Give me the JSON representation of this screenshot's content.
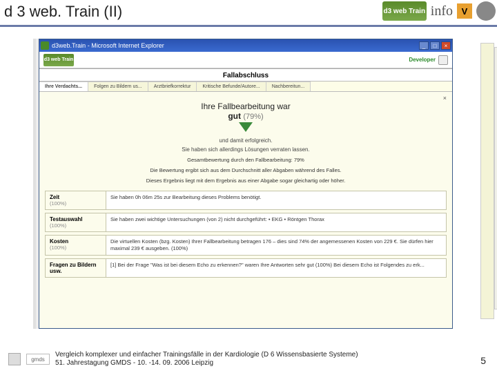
{
  "slide": {
    "title": "d 3 web. Train (II)",
    "page_number": "5"
  },
  "logos": {
    "d3web": "d3 web Train",
    "info": "info",
    "v": "V"
  },
  "browser": {
    "title": "d3web.Train - Microsoft Internet Explorer",
    "mini_logo": "d3 web Train",
    "developer": "Developer"
  },
  "page": {
    "header": "Fallabschluss",
    "tabs": [
      "Ihre Verdachts...",
      "Folgen zu Bildern us...",
      "Arztbriefkorrektur",
      "Kritische Befunde/Autore...",
      "Nachbereitun..."
    ],
    "close": "×",
    "result": {
      "line1": "Ihre Fallbearbeitung war",
      "good": "gut",
      "pct": "(79%)",
      "sub1": "und damit erfolgreich.",
      "sub2": "Sie haben sich allerdings Lösungen verraten lassen.",
      "para1": "Gesamtbewertung durch den Fallbearbeitung: 79%",
      "para2": "Die Bewertung ergibt sich aus dem Durchschnitt aller Abgaben während des Falles.",
      "para3": "Dieses Ergebnis liegt mit dem Ergebnis aus einer Abgabe sogar gleichartig oder höher."
    },
    "rows": [
      {
        "label": "Zeit",
        "score": "(100%)",
        "body": "Sie haben 0h 06m 25s zur Bearbeitung dieses Problems benötigt."
      },
      {
        "label": "Testauswahl",
        "score": "(100%)",
        "body": "Sie haben zwei wichtige Untersuchungen (von 2) nicht durchgeführt: • EKG • Röntgen Thorax"
      },
      {
        "label": "Kosten",
        "score": "(100%)",
        "body": "Die virtuellen Kosten (bzg. Kosten) Ihrer Fallbearbeitung betragen 176 – dies sind 74% der angemessenen Kosten von 229 €. Sie dürfen hier maximal 239 € ausgeben. (100%)"
      },
      {
        "label": "Fragen zu Bildern usw.",
        "score": "",
        "body": "[1] Bei der Frage \"Was ist bei diesem Echo zu erkennen?\" waren Ihre Antworten sehr gut (100%)\nBei diesem Echo ist Folgendes zu erk..."
      }
    ]
  },
  "footer": {
    "gmds": "gmds",
    "line1": "Vergleich komplexer und einfacher Trainingsfälle in der Kardiologie (D 6 Wissensbasierte Systeme)",
    "line2": "51. Jahrestagung GMDS - 10. -14. 09. 2006 Leipzig"
  }
}
